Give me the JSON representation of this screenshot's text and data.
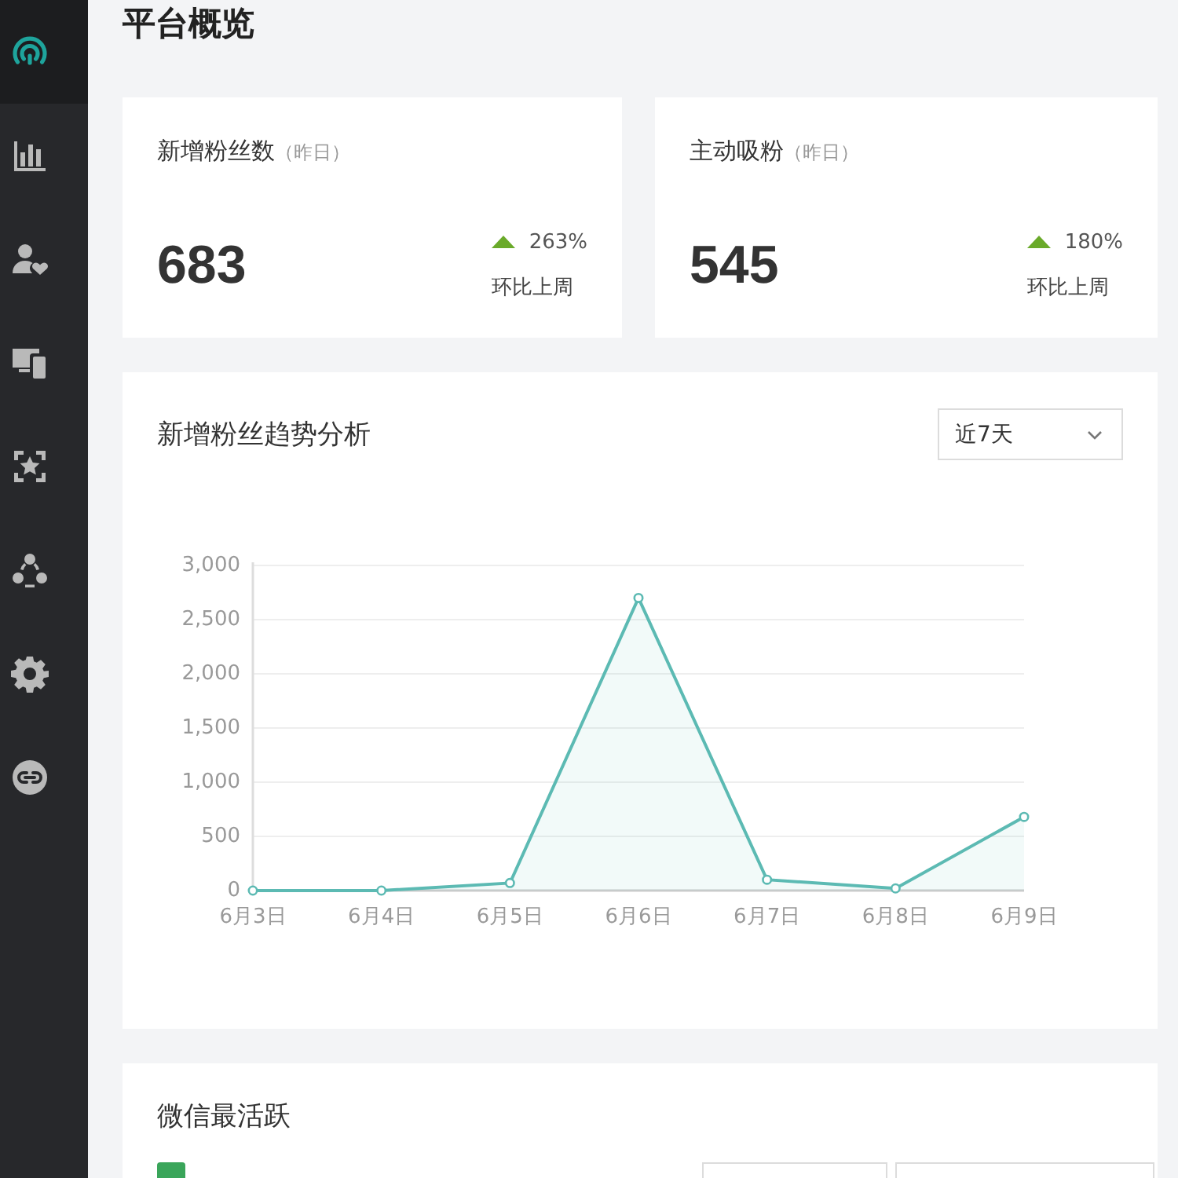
{
  "sidebar": {
    "items": [
      {
        "selected": true
      },
      {
        "selected": false
      },
      {
        "selected": false
      },
      {
        "selected": false
      },
      {
        "selected": false
      },
      {
        "selected": false
      },
      {
        "selected": false
      },
      {
        "selected": false
      }
    ]
  },
  "page_title": "平台概览",
  "stat_cards": [
    {
      "title": "新增粉丝数",
      "period": "（昨日）",
      "value": "683",
      "rising": true,
      "change": "263%",
      "compare_label": "环比上周"
    },
    {
      "title": "主动吸粉",
      "period": "（昨日）",
      "value": "545",
      "rising": true,
      "change": "180%",
      "compare_label": "环比上周"
    }
  ],
  "trend_panel": {
    "title": "新增粉丝趋势分析",
    "range_select": {
      "value": "近7天"
    },
    "chart_data": {
      "type": "area",
      "categories": [
        "6月3日",
        "6月4日",
        "6月5日",
        "6月6日",
        "6月7日",
        "6月8日",
        "6月9日"
      ],
      "series": [
        {
          "color": "#5cbab3",
          "values": [
            0,
            0,
            70,
            2700,
            100,
            20,
            680
          ]
        }
      ],
      "ylim": [
        0,
        3000
      ],
      "yticks": [
        {
          "value": 0,
          "label": "0"
        },
        {
          "value": 500,
          "label": "500"
        },
        {
          "value": 1000,
          "label": "1,000"
        },
        {
          "value": 1500,
          "label": "1,500"
        },
        {
          "value": 2000,
          "label": "2,000"
        },
        {
          "value": 2500,
          "label": "2,500"
        },
        {
          "value": 3000,
          "label": "3,000"
        }
      ],
      "grid": true
    }
  },
  "active_panel": {
    "title": "微信最活跃"
  }
}
